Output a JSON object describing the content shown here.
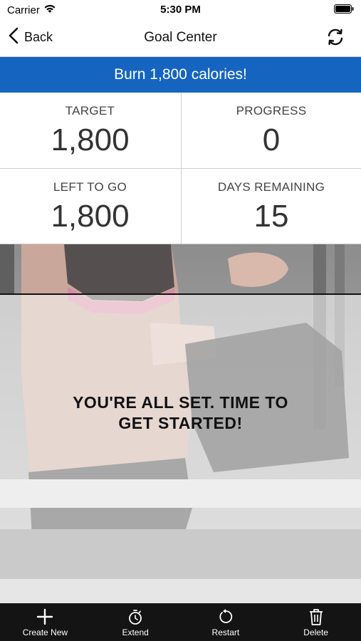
{
  "status_bar": {
    "carrier": "Carrier",
    "time": "5:30 PM",
    "icons": [
      "wifi-icon",
      "battery-icon"
    ]
  },
  "nav": {
    "back_label": "Back",
    "title": "Goal Center",
    "icons": [
      "chevron-left-icon",
      "refresh-icon"
    ]
  },
  "banner": {
    "text": "Burn 1,800 calories!",
    "color": "#1565c0"
  },
  "stats": {
    "target": {
      "label": "TARGET",
      "value": "1,800"
    },
    "progress": {
      "label": "PROGRESS",
      "value": "0"
    },
    "left_to_go": {
      "label": "LEFT TO GO",
      "value": "1,800"
    },
    "days_remaining": {
      "label": "DAYS REMAINING",
      "value": "15"
    }
  },
  "message": {
    "line1": "YOU'RE ALL SET. TIME TO",
    "line2": "GET STARTED!"
  },
  "tab_bar": {
    "items": [
      {
        "label": "Create New",
        "icon": "plus-icon"
      },
      {
        "label": "Extend",
        "icon": "stopwatch-icon"
      },
      {
        "label": "Restart",
        "icon": "restart-icon"
      },
      {
        "label": "Delete",
        "icon": "trash-icon"
      }
    ]
  }
}
